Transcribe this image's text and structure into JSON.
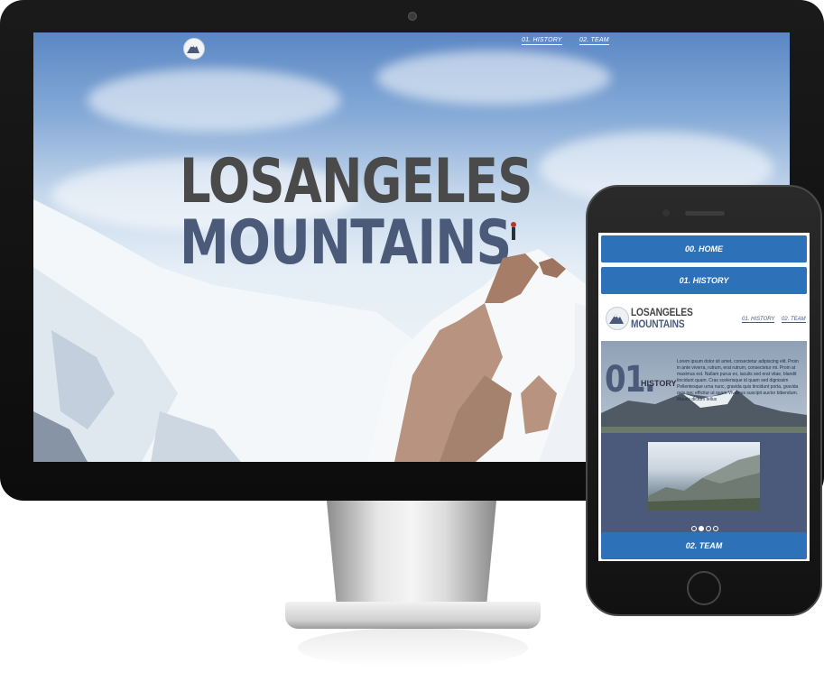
{
  "desktop": {
    "nav": [
      "01. HISTORY",
      "02. TEAM"
    ],
    "title_line1": "LOSANGELES",
    "title_line2": "MOUNTAINS"
  },
  "mobile": {
    "tabs": {
      "home": "00. HOME",
      "history": "01. HISTORY",
      "team": "02. TEAM"
    },
    "brand_line1": "LOSANGELES",
    "brand_line2": "MOUNTAINS",
    "nav": [
      "01. HISTORY",
      "02. TEAM"
    ],
    "section_number": "01.",
    "section_title": "HISTORY",
    "body_text": "Lorem ipsum dolor sit amet, consectetur adipiscing elit. Proin in ante viverra, rutrum, erat rutrum, consectetur mi. Proin at maximus est. Nullam purus ex, iaculis sed erat vitae, blandit tincidunt quam. Cras scelerisque id quam sed dignissim Pellentesque urna nunc, gravida quis tincidunt porta, gravida quis nec efficitur ut quam Vivamus suscipit auctor bibendum. Mauris dictum tellus",
    "carousel": {
      "slides": 4,
      "active_index": 1
    }
  },
  "colors": {
    "tab_blue": "#2d72b8",
    "brand_slate": "#4a5a78",
    "title_grey": "#4a4a4a"
  }
}
